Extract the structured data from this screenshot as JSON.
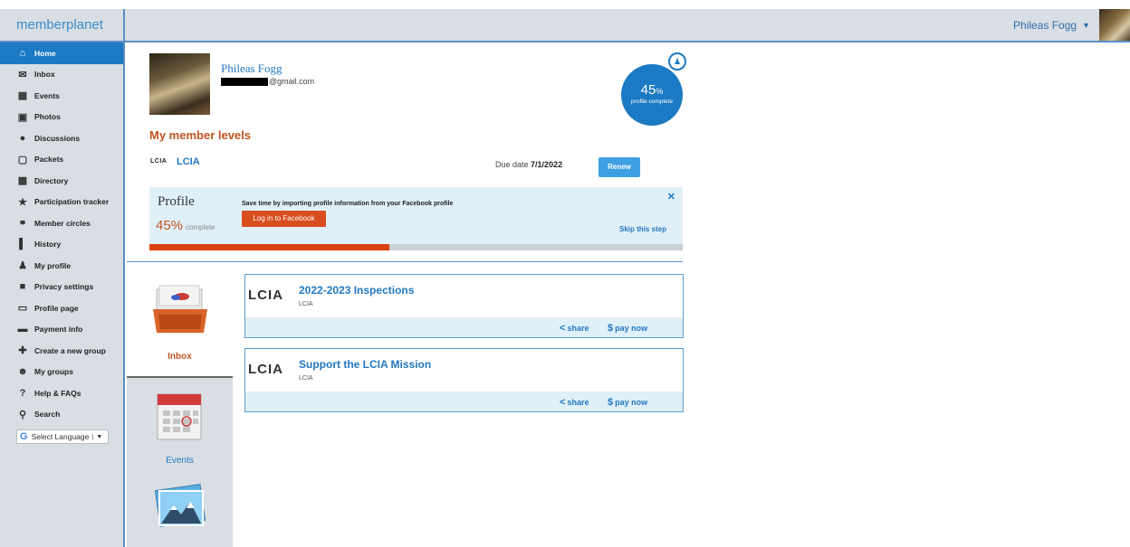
{
  "header": {
    "logo": "memberplanet",
    "user_name": "Phileas Fogg",
    "chevron_icon": "chevron-down-icon"
  },
  "sidebar": {
    "items": [
      {
        "label": "Home",
        "icon": "home-icon",
        "active": true
      },
      {
        "label": "Inbox",
        "icon": "envelope-icon"
      },
      {
        "label": "Events",
        "icon": "calendar-icon"
      },
      {
        "label": "Photos",
        "icon": "camera-icon"
      },
      {
        "label": "Discussions",
        "icon": "chat-bubble-icon"
      },
      {
        "label": "Packets",
        "icon": "packet-icon"
      },
      {
        "label": "Directory",
        "icon": "directory-icon"
      },
      {
        "label": "Participation tracker",
        "icon": "star-icon"
      },
      {
        "label": "Member circles",
        "icon": "circles-icon"
      },
      {
        "label": "History",
        "icon": "bar-chart-icon"
      },
      {
        "label": "My profile",
        "icon": "person-icon"
      },
      {
        "label": "Privacy settings",
        "icon": "lock-icon"
      },
      {
        "label": "Profile page",
        "icon": "monitor-icon"
      },
      {
        "label": "Payment info",
        "icon": "card-icon"
      },
      {
        "label": "Create a new group",
        "icon": "plus-icon"
      },
      {
        "label": "My groups",
        "icon": "group-icon"
      },
      {
        "label": "Help & FAQs",
        "icon": "question-icon"
      },
      {
        "label": "Search",
        "icon": "search-icon"
      }
    ],
    "language_select": "Select Language"
  },
  "profile": {
    "name": "Phileas Fogg",
    "email_suffix": "@gmail.com",
    "completion_percent": 45,
    "completion_pct_text": "45",
    "completion_pct_sign": "%",
    "completion_label": "profile complete"
  },
  "member_levels": {
    "title": "My member levels",
    "level_logo": "LCIA",
    "level_name": "LCIA",
    "due_label": "Due date",
    "due_date": "7/1/2022",
    "renew_button": "Renew"
  },
  "profile_box": {
    "title": "Profile",
    "percent_text": "45%",
    "percent_label": "complete",
    "percent_fraction": 0.45,
    "message": "Save time by importing profile information from your Facebook profile",
    "facebook_button": "Log in to Facebook",
    "skip_link": "Skip this step",
    "close_icon": "close-icon"
  },
  "apps": [
    {
      "label": "Inbox",
      "icon": "inbox-tray-icon"
    },
    {
      "label": "Events",
      "icon": "calendar-icon"
    },
    {
      "label": "",
      "icon": "photos-icon"
    }
  ],
  "feed": [
    {
      "logo": "LCIA",
      "title": "2022-2023 Inspections",
      "org": "LCIA",
      "share": "share",
      "pay": "pay now"
    },
    {
      "logo": "LCIA",
      "title": "Support the LCIA Mission",
      "org": "LCIA",
      "share": "share",
      "pay": "pay now"
    }
  ],
  "colors": {
    "accent": "#1b7ac3",
    "orange": "#c25320",
    "sidebar_bg": "#d9dee4"
  }
}
